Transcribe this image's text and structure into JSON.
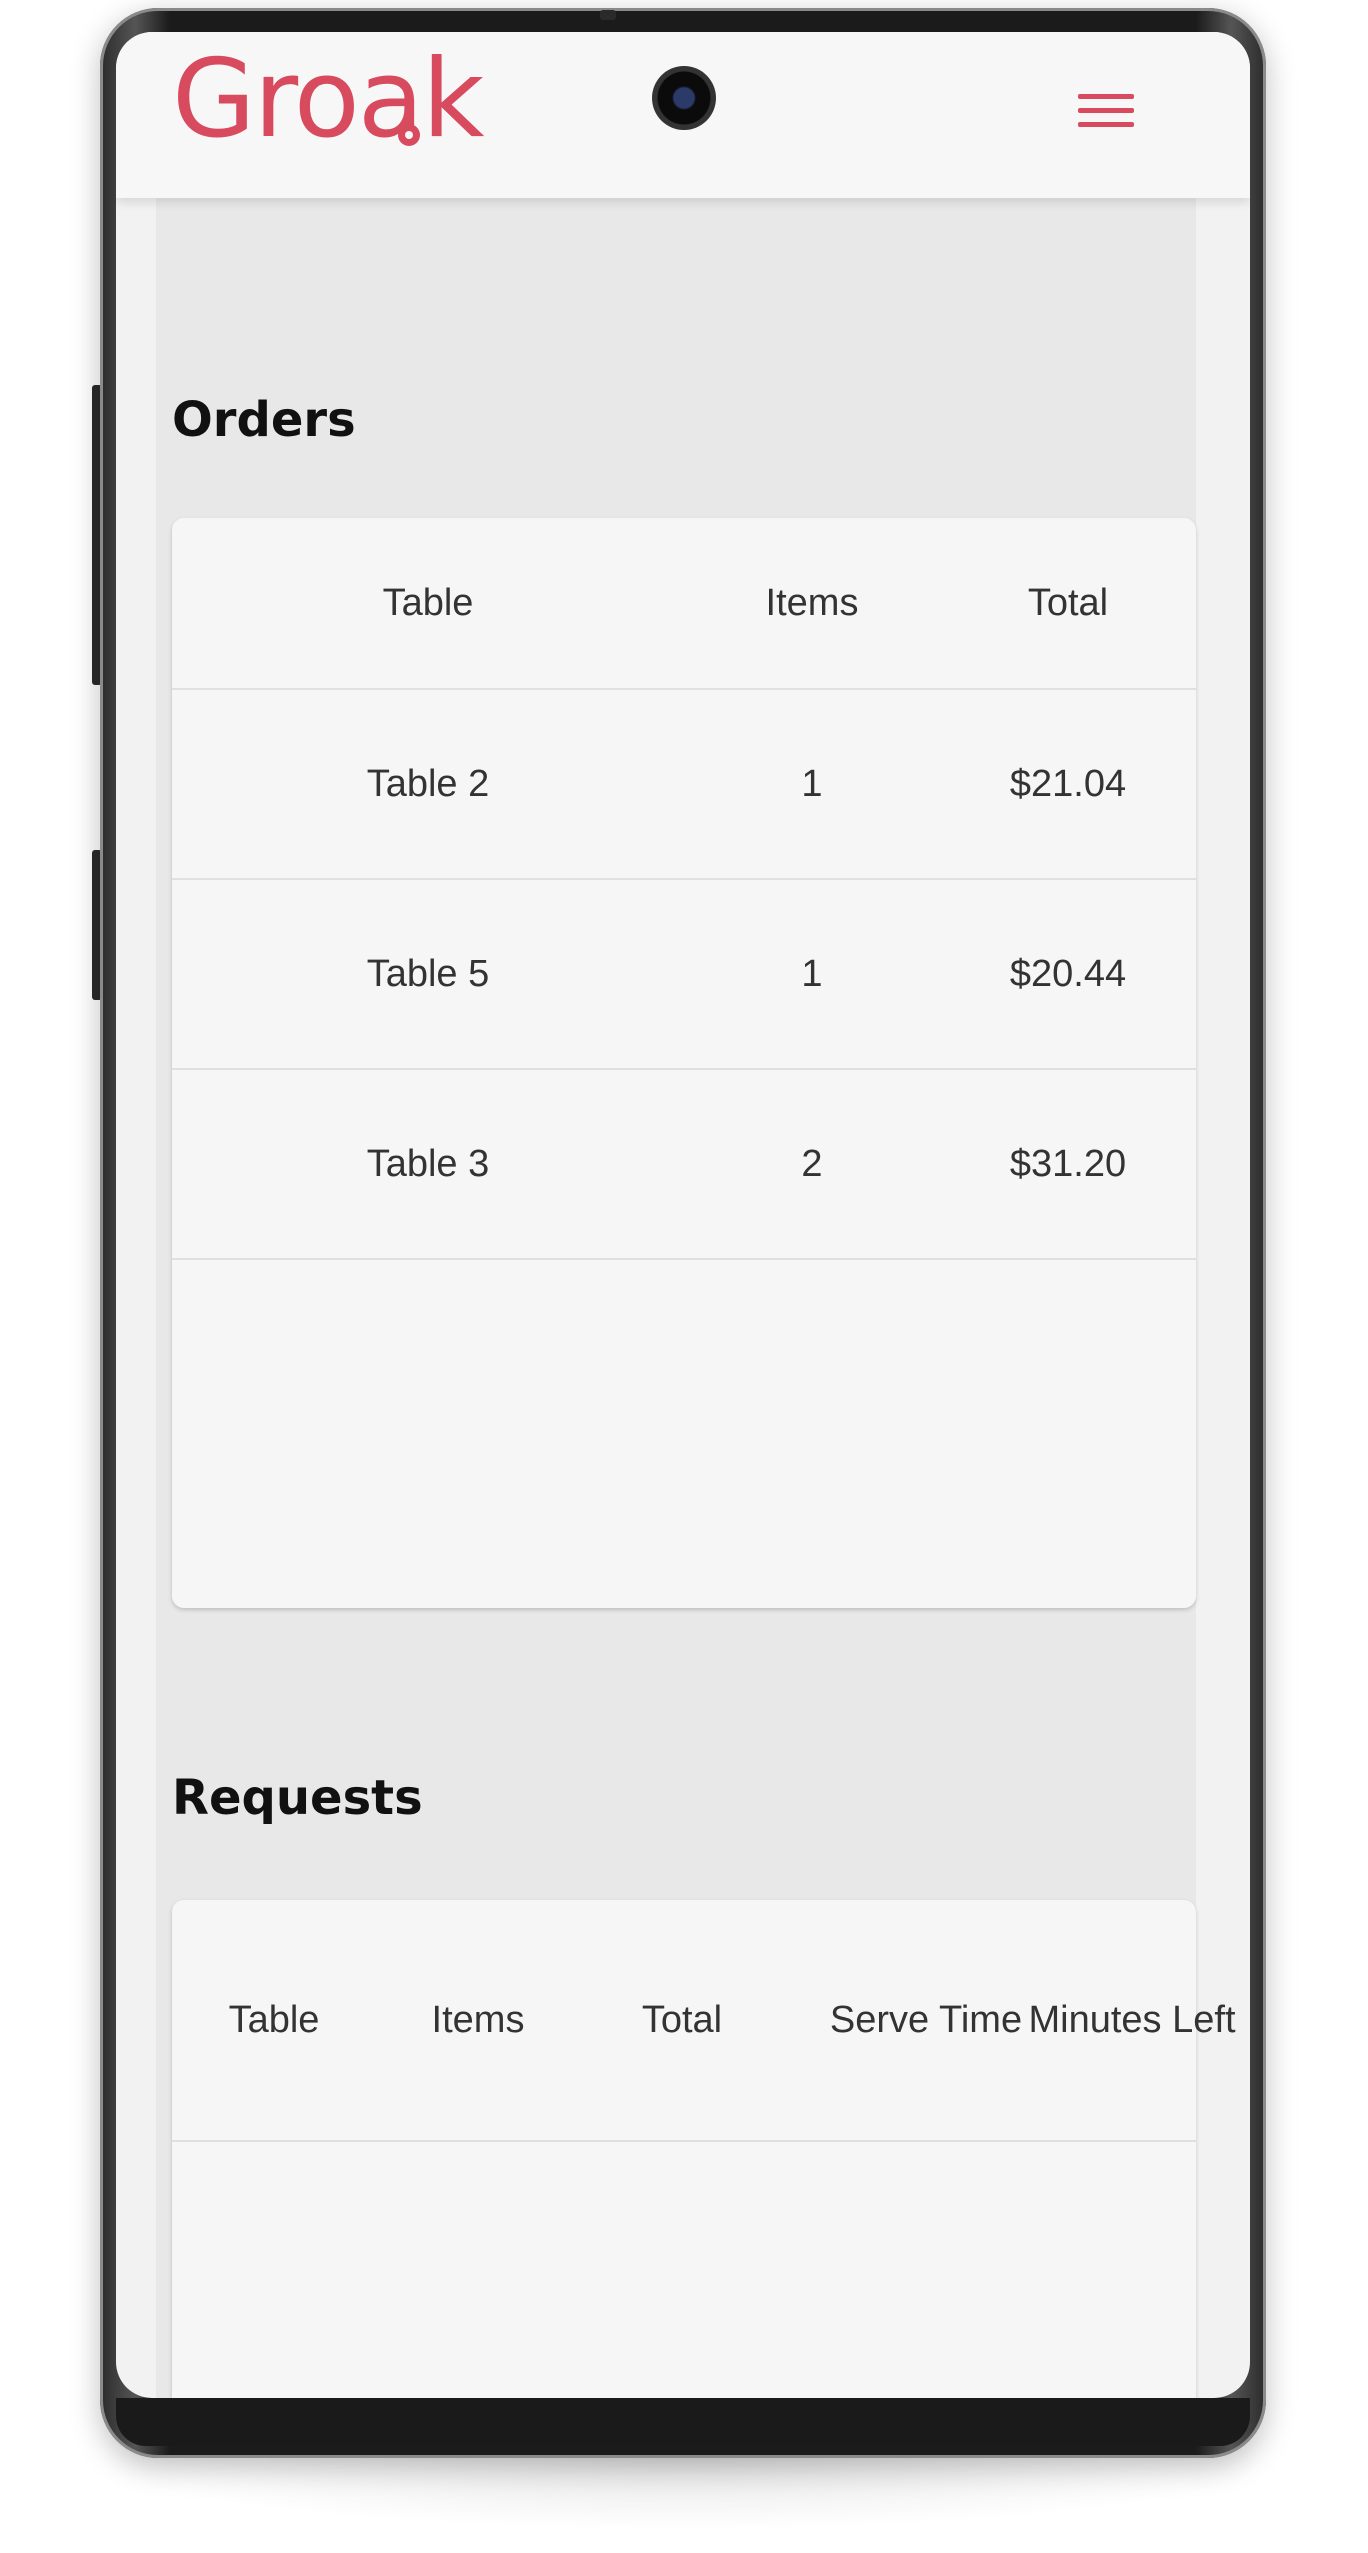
{
  "app": {
    "logo_text": "Groak"
  },
  "header": {
    "menu_icon": "hamburger-menu-icon",
    "accent_color": "#d84a5e"
  },
  "orders": {
    "title": "Orders",
    "columns": [
      "Table",
      "Items",
      "Total"
    ],
    "rows": [
      {
        "table": "Table 2",
        "items": "1",
        "total": "$21.04"
      },
      {
        "table": "Table 5",
        "items": "1",
        "total": "$20.44"
      },
      {
        "table": "Table 3",
        "items": "2",
        "total": "$31.20"
      }
    ]
  },
  "requests": {
    "title": "Requests",
    "columns": [
      "Table",
      "Items",
      "Total",
      "Serve Time",
      "Minutes Left"
    ],
    "rows": []
  }
}
